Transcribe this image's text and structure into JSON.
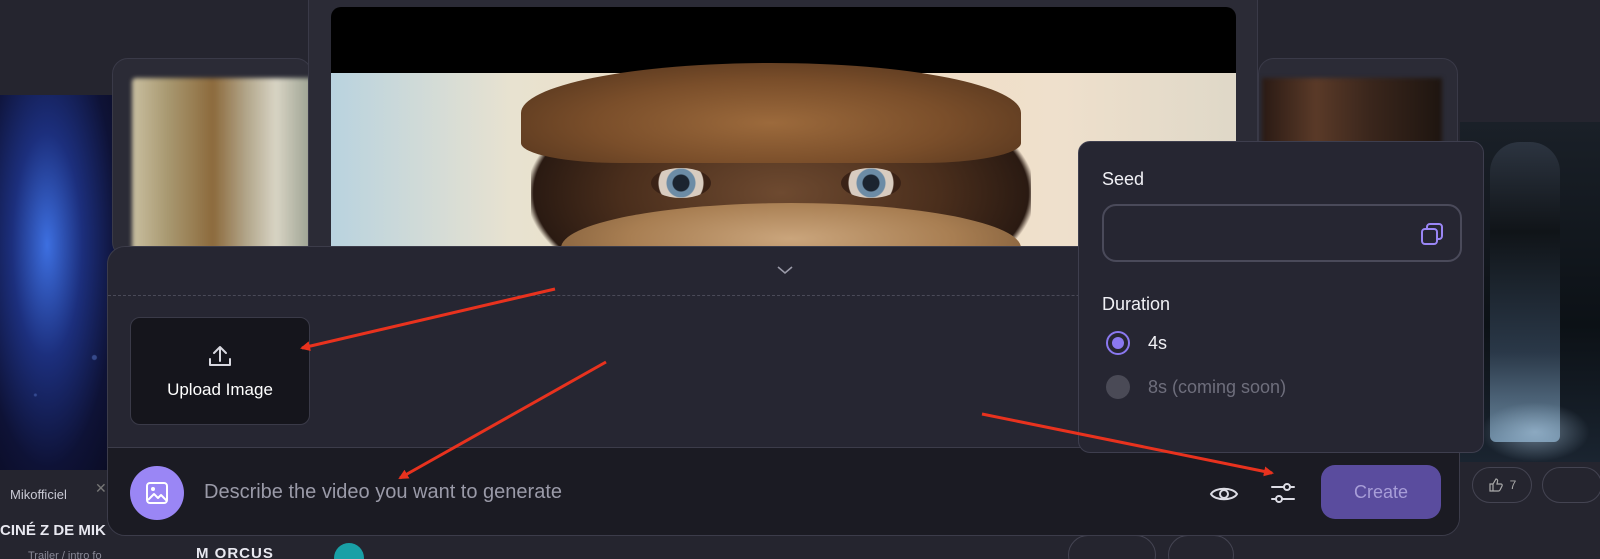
{
  "background": {
    "left_user": "Mikofficiel",
    "left_title": "CINÉ Z DE MIK",
    "left_subtitle": "Trailer / intro fo",
    "orcus_label": "M ORCUS",
    "like_count": "7"
  },
  "panel": {
    "upload_label": "Upload Image",
    "prompt_placeholder": "Describe the video you want to generate",
    "create_label": "Create"
  },
  "settings": {
    "seed_label": "Seed",
    "seed_value": "",
    "duration_label": "Duration",
    "duration_options": [
      {
        "label": "4s",
        "selected": true,
        "enabled": true
      },
      {
        "label": "8s (coming soon)",
        "selected": false,
        "enabled": false
      }
    ]
  },
  "icons": {
    "upload": "upload-icon",
    "image": "image-icon",
    "preview": "eye-icon",
    "settings": "sliders-icon",
    "copy": "copy-icon",
    "collapse": "chevron-down-icon"
  },
  "colors": {
    "accent": "#9a86f5",
    "create_button": "#5a4c9e",
    "annotation_arrow": "#e8321e"
  }
}
